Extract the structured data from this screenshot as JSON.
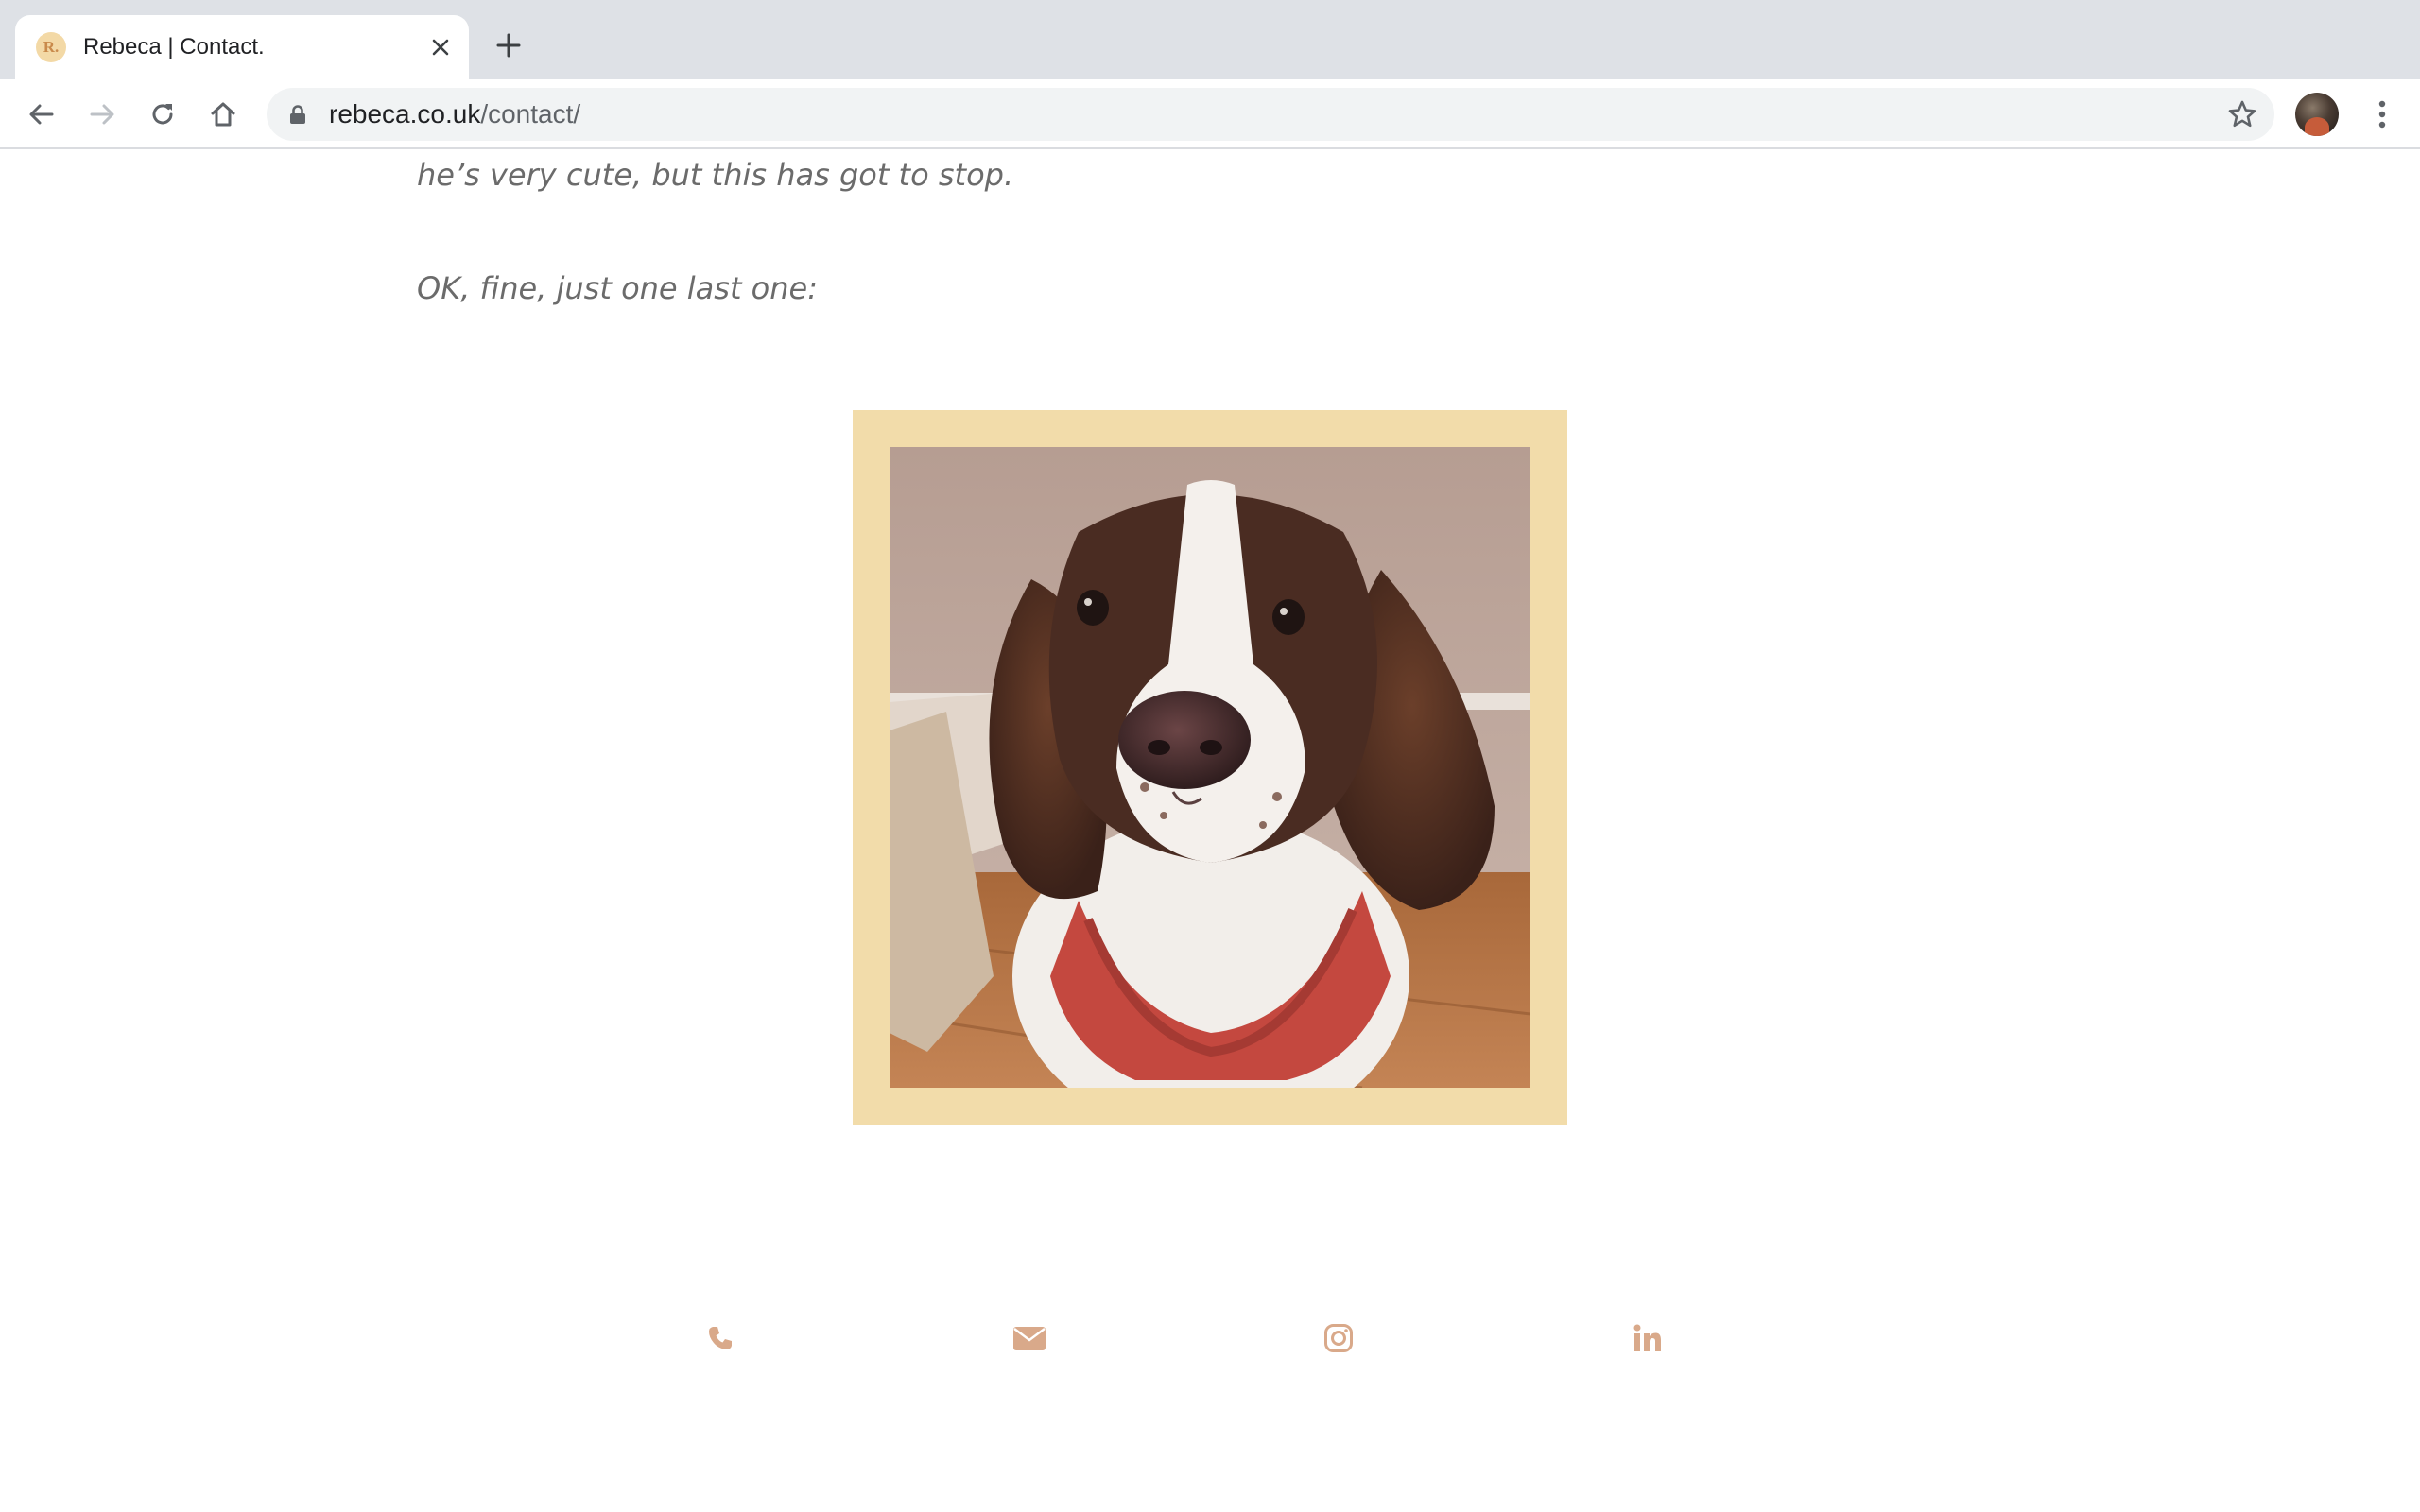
{
  "browser": {
    "tab_title": "Rebeca | Contact.",
    "favicon_text": "R.",
    "url_domain": "rebeca.co.uk",
    "url_path": "/contact/"
  },
  "page": {
    "paragraphs": [
      "he’s very cute, but this has got to stop.",
      "OK, fine, just one last one:"
    ],
    "photo_subject": "springer spaniel in red jumper",
    "frame_color": "#f2dcaa",
    "icon_color": "#d9a98a"
  },
  "footer": {
    "icons": [
      "phone-icon",
      "email-icon",
      "instagram-icon",
      "linkedin-icon"
    ]
  }
}
